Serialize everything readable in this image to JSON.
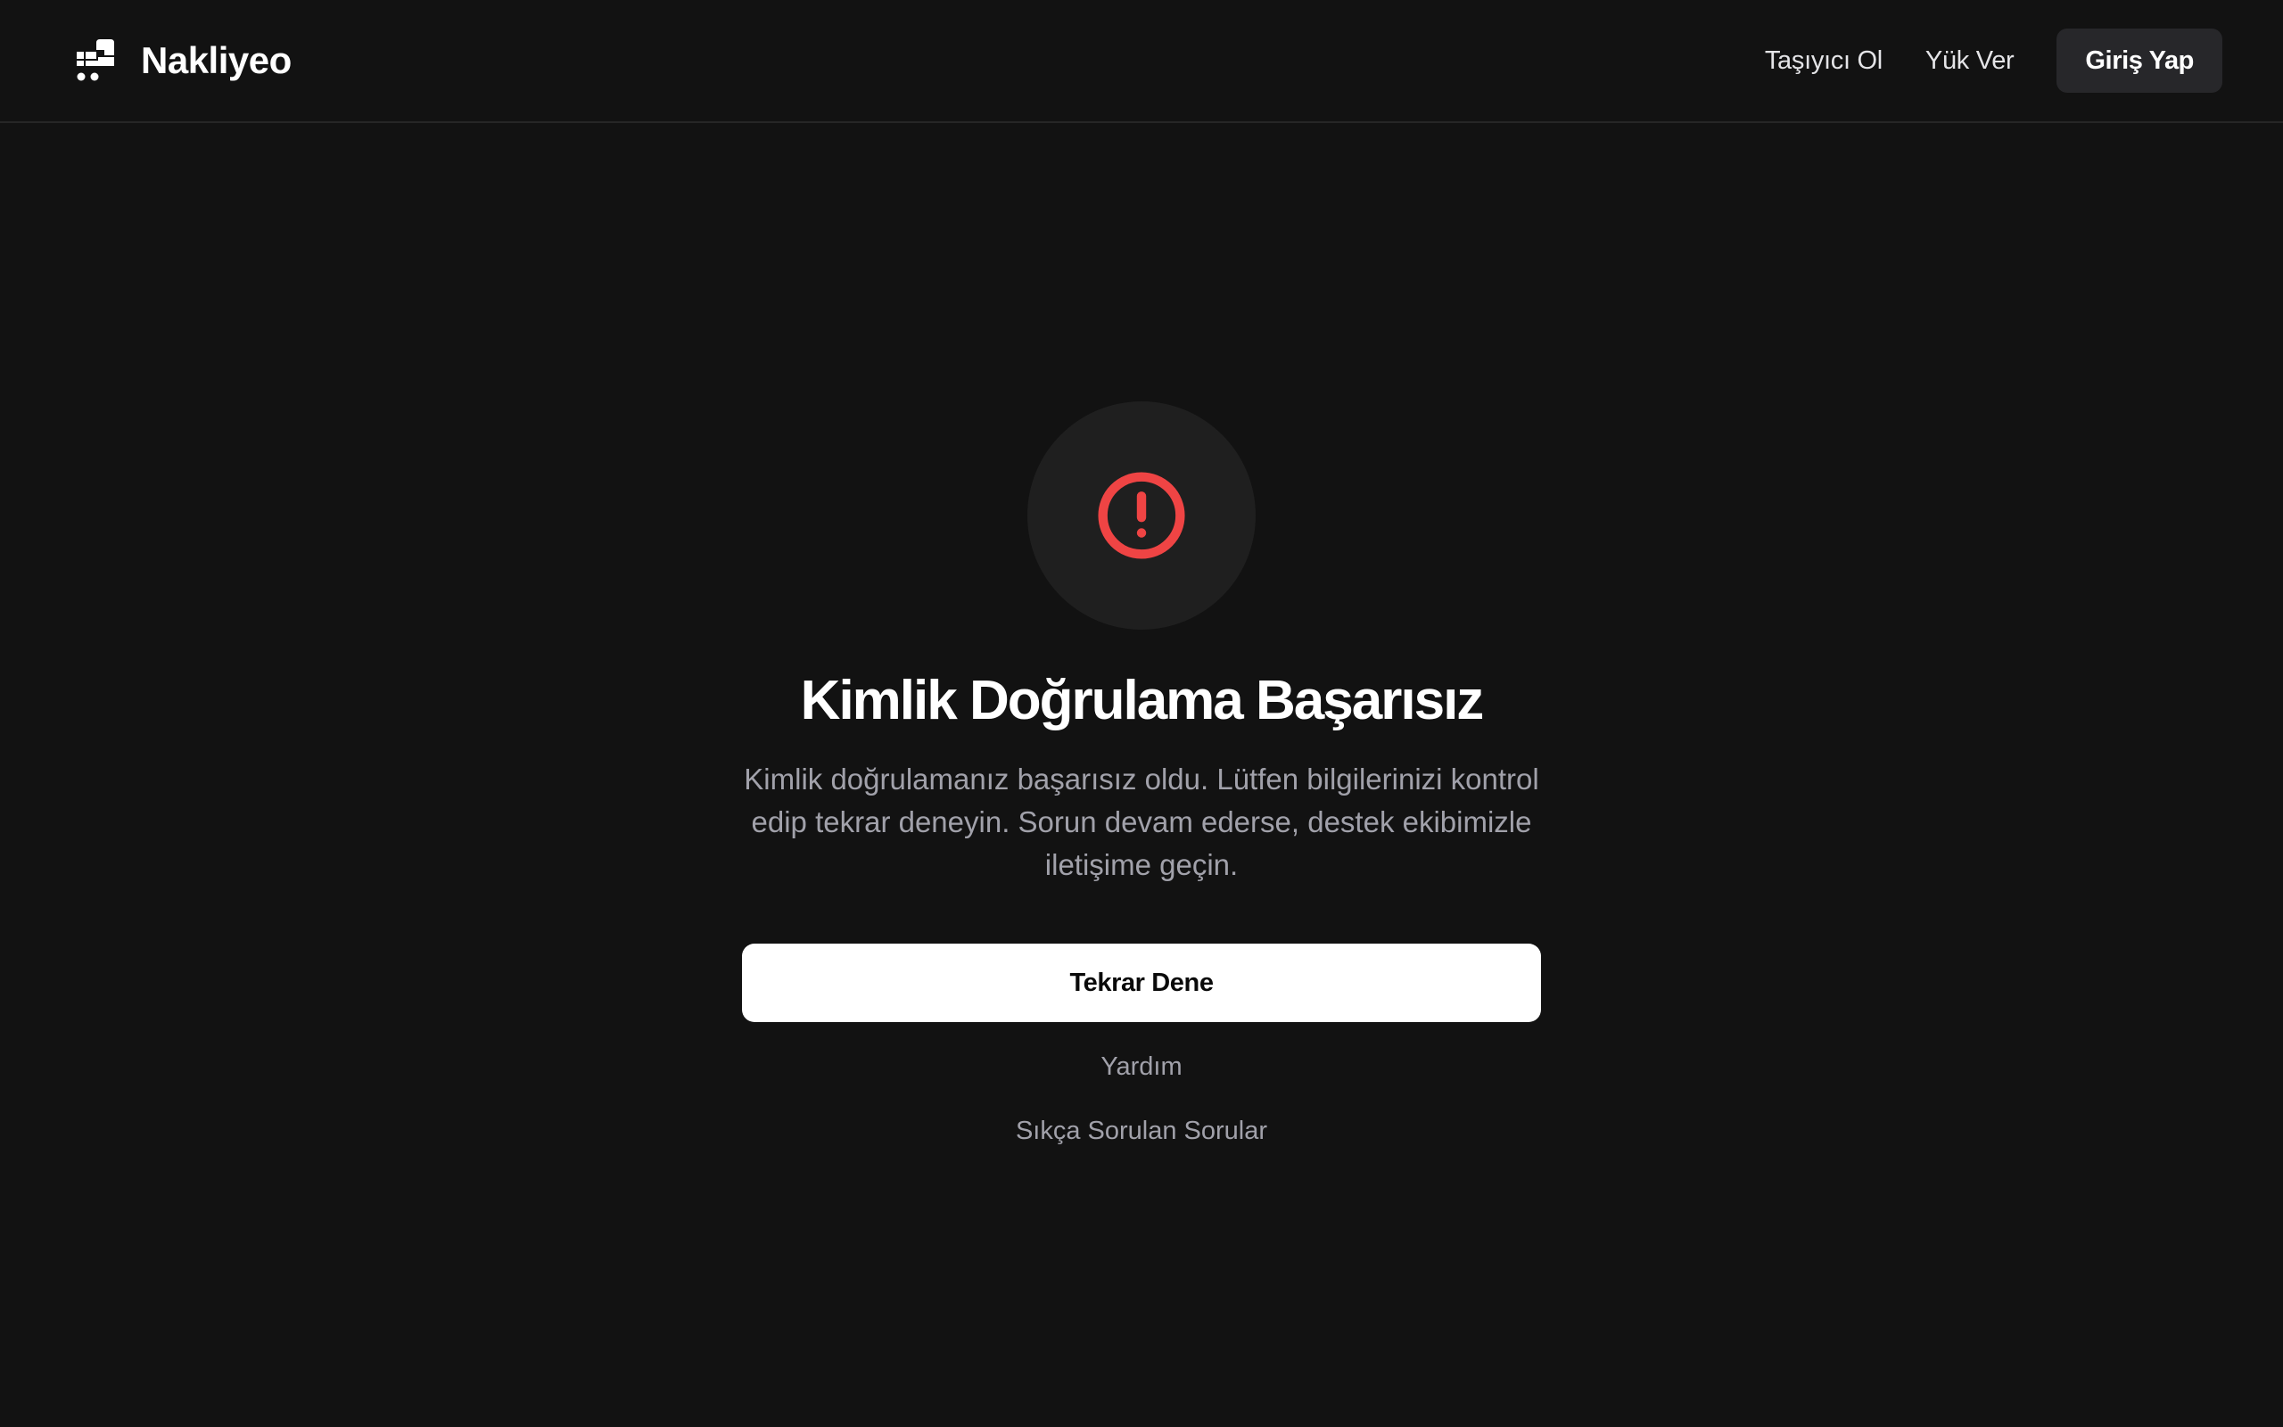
{
  "header": {
    "brand_name": "Nakliyeo",
    "nav_links": [
      {
        "label": "Taşıyıcı Ol"
      },
      {
        "label": "Yük Ver"
      }
    ],
    "login_label": "Giriş Yap"
  },
  "error": {
    "icon": "alert-circle-icon",
    "title": "Kimlik Doğrulama Başarısız",
    "description": "Kimlik doğrulamanız başarısız oldu. Lütfen bilgilerinizi kontrol edip tekrar deneyin. Sorun devam ederse, destek ekibimizle iletişime geçin.",
    "retry_label": "Tekrar Dene",
    "help_label": "Yardım",
    "faq_label": "Sıkça Sorulan Sorular"
  },
  "colors": {
    "background": "#121212",
    "error_red": "#ef4444",
    "icon_circle": "#1f1f1f",
    "muted_text": "#a1a1aa",
    "nav_button_bg": "#27272a",
    "primary_button_bg": "#ffffff"
  }
}
